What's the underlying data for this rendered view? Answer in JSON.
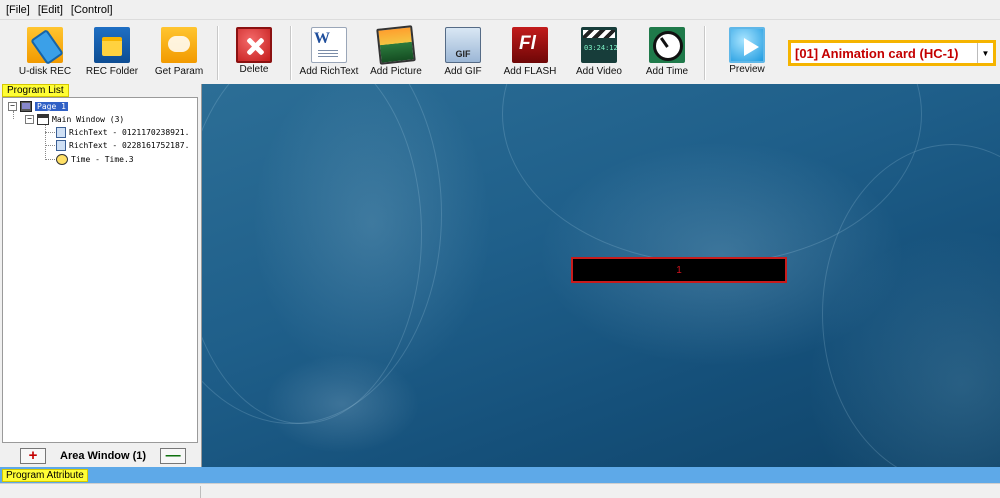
{
  "menu": [
    "[File]",
    "[Edit]",
    "[Control]"
  ],
  "toolbar": {
    "udisk_rec": "U-disk REC",
    "rec_folder": "REC Folder",
    "get_param": "Get Param",
    "delete": "Delete",
    "add_richtext": "Add RichText",
    "add_picture": "Add Picture",
    "add_gif": "Add GIF",
    "add_flash": "Add FLASH",
    "add_video": "Add Video",
    "add_time": "Add Time",
    "preview": "Preview"
  },
  "card_select": {
    "value": "[01] Animation card (HC-1)"
  },
  "program_list": {
    "header": "Program List",
    "tree": {
      "page": "Page 1",
      "main_window": "Main Window  (3)",
      "items": [
        "RichText - 0121170238921.",
        "RichText - 0228161752187.",
        "Time - Time.3"
      ]
    }
  },
  "area_window": {
    "label": "Area Window (1)",
    "add": "+",
    "remove": "—"
  },
  "canvas": {
    "text_box": "1"
  },
  "program_attribute": {
    "header": "Program Attribute"
  },
  "colors": {
    "accent_yellow": "#fffe35",
    "canvas_blue": "#1f5f8a",
    "attr_bar": "#5ea9e8",
    "highlight_red": "#c81c1c"
  }
}
